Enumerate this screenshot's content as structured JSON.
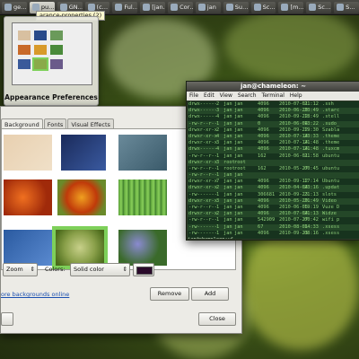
{
  "panel": {
    "tasks": [
      {
        "label": "ge…",
        "active": false
      },
      {
        "label": "pu…",
        "active": true
      },
      {
        "label": "GN…",
        "active": false
      },
      {
        "label": "(c…",
        "active": false
      },
      {
        "label": "Ful…",
        "active": false
      },
      {
        "label": "[jan…",
        "active": false
      },
      {
        "label": "Cor…",
        "active": false
      },
      {
        "label": "jan",
        "active": false
      },
      {
        "label": "Su…",
        "active": false
      },
      {
        "label": "Sc…",
        "active": false
      },
      {
        "label": "[m…",
        "active": false
      },
      {
        "label": "Sc…",
        "active": false
      },
      {
        "label": "S…",
        "active": false
      }
    ],
    "tooltip": "arance-properties (2)"
  },
  "switcher": {
    "caption": "Appearance Preferences"
  },
  "dialog": {
    "tabs": [
      "Background",
      "Fonts",
      "Visual Effects"
    ],
    "style_value": "Zoom",
    "colors_label": "Colors:",
    "colors_value": "Solid color",
    "color_swatch": "#2a0a2a",
    "more_link": "ore backgrounds online",
    "remove_label": "Remove",
    "add_label": "Add",
    "close_label": "Close"
  },
  "terminal": {
    "title": "jan@chameleon: ~",
    "menu": [
      "File",
      "Edit",
      "View",
      "Search",
      "Terminal",
      "Help"
    ],
    "rows": [
      {
        "perm": "drwx------",
        "n": "2",
        "u": "jan",
        "g": "jan",
        "size": "4096",
        "date": "2010-07-01",
        "time": "21:12",
        "name": ".ssh"
      },
      {
        "perm": "drwx------",
        "n": "3",
        "u": "jan",
        "g": "jan",
        "size": "4096",
        "date": "2010-06-29",
        "time": "23:49",
        "name": ".starc"
      },
      {
        "perm": "drwx------",
        "n": "4",
        "u": "jan",
        "g": "jan",
        "size": "4096",
        "date": "2010-09-22",
        "time": "18:49",
        "name": ".stell"
      },
      {
        "perm": "-rw-r--r--",
        "n": "1",
        "u": "jan",
        "g": "jan",
        "size": "0",
        "date": "2010-06-04",
        "time": "13:22",
        "name": ".sudo_"
      },
      {
        "perm": "drwxr-xr-x",
        "n": "2",
        "u": "jan",
        "g": "jan",
        "size": "4096",
        "date": "2010-09-22",
        "time": "19:30",
        "name": "Szabla"
      },
      {
        "perm": "drwxr-xr-x",
        "n": "4",
        "u": "jan",
        "g": "jan",
        "size": "4096",
        "date": "2010-07-14",
        "time": "23:33",
        "name": ".theme"
      },
      {
        "perm": "drwxr-xr-x",
        "n": "3",
        "u": "jan",
        "g": "jan",
        "size": "4096",
        "date": "2010-07-14",
        "time": "21:48",
        "name": ".theme"
      },
      {
        "perm": "drwx------",
        "n": "4",
        "u": "jan",
        "g": "jan",
        "size": "4096",
        "date": "2010-07-14",
        "time": "21:48",
        "name": ".tuxcm"
      },
      {
        "perm": "-rw-r--r--",
        "n": "1",
        "u": "jan",
        "g": "jan",
        "size": "162",
        "date": "2010-06-01",
        "time": "21:58",
        "name": "ubuntu"
      },
      {
        "perm": "drwxr-xr-x",
        "n": "3",
        "u": "root",
        "g": "root",
        "size": "",
        "date": "",
        "time": "",
        "name": ""
      },
      {
        "perm": "-rw-r--r--",
        "n": "1",
        "u": "root",
        "g": "root",
        "size": "162",
        "date": "2010-05-27",
        "time": "00:45",
        "name": "ubuntu"
      },
      {
        "perm": "-rw-r--r--",
        "n": "1",
        "u": "jan",
        "g": "jan",
        "size": "",
        "date": "",
        "time": "",
        "name": ""
      },
      {
        "perm": "drwxr-xr-x",
        "n": "7",
        "u": "jan",
        "g": "jan",
        "size": "4096",
        "date": "2010-09-12",
        "time": "17:14",
        "name": "Ubuntu"
      },
      {
        "perm": "drwxr-xr-x",
        "n": "2",
        "u": "jan",
        "g": "jan",
        "size": "4096",
        "date": "2010-04-04",
        "time": "23:16",
        "name": ".updat"
      },
      {
        "perm": "-rw-------",
        "n": "1",
        "u": "jan",
        "g": "jan",
        "size": "306681",
        "date": "2010-09-23",
        "time": "21:13",
        "name": "slots"
      },
      {
        "perm": "drwxr-xr-x",
        "n": "3",
        "u": "jan",
        "g": "jan",
        "size": "4096",
        "date": "2010-05-29",
        "time": "21:49",
        "name": "Video"
      },
      {
        "perm": "-rw-r--r--",
        "n": "1",
        "u": "jan",
        "g": "jan",
        "size": "4096",
        "date": "2010-06-05",
        "time": "19:19",
        "name": "Vuze D"
      },
      {
        "perm": "drwxr-xr-x",
        "n": "2",
        "u": "jan",
        "g": "jan",
        "size": "4096",
        "date": "2010-07-04",
        "time": "21:13",
        "name": "Widze"
      },
      {
        "perm": "-rw-r--r--",
        "n": "1",
        "u": "jan",
        "g": "jan",
        "size": "542909",
        "date": "2010-07-27",
        "time": "00:42",
        "name": "wifi p"
      },
      {
        "perm": "-rw-------",
        "n": "1",
        "u": "jan",
        "g": "jan",
        "size": "67",
        "date": "2010-08-01",
        "time": "14:33",
        "name": ".xsess"
      },
      {
        "perm": "-rw-------",
        "n": "1",
        "u": "jan",
        "g": "jan",
        "size": "4096",
        "date": "2010-09-23",
        "time": "08:16",
        "name": ".xsess"
      }
    ],
    "prompt": "jan@chameleon:~$"
  }
}
